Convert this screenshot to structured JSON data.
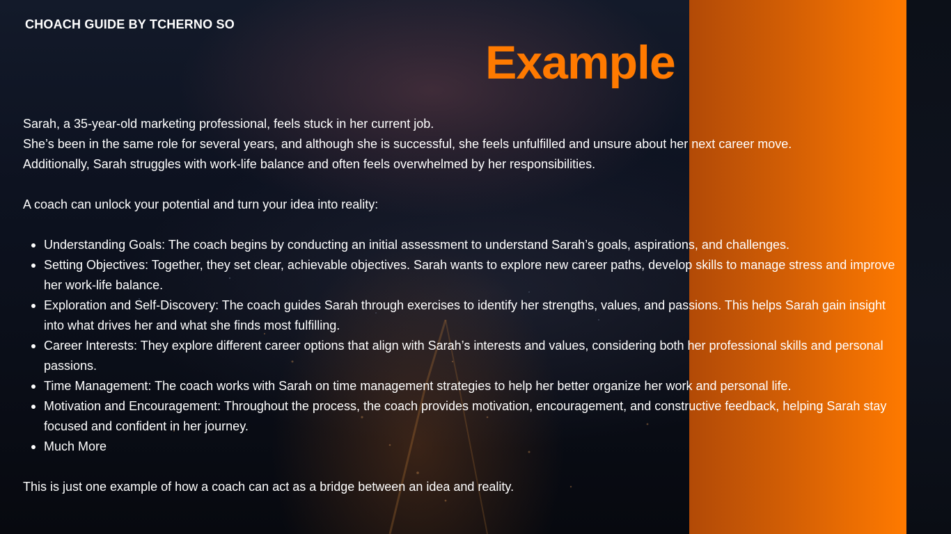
{
  "brand": "CHOACH GUIDE BY TCHERNO SO",
  "title": "Example",
  "intro": [
    "Sarah, a 35-year-old marketing professional, feels stuck in her current job.",
    "She’s been in the same role for several years, and although she is successful, she feels unfulfilled and unsure about her next career move.",
    "Additionally, Sarah struggles with work-life balance and often feels overwhelmed by her responsibilities."
  ],
  "lead": "A coach can unlock your potential and turn your idea into reality:",
  "bullets": [
    "Understanding Goals: The coach begins by conducting an initial assessment to understand Sarah’s goals, aspirations, and challenges.",
    "Setting Objectives: Together, they set clear, achievable objectives. Sarah wants to explore new career paths, develop skills to manage stress and improve her work-life balance.",
    "Exploration and Self-Discovery: The coach guides Sarah through exercises to identify her strengths, values, and passions. This helps Sarah gain insight into what drives her and what she finds most fulfilling.",
    "Career Interests: They explore different career options that align with Sarah’s interests and values, considering both her professional skills and personal passions.",
    "Time Management: The coach works with Sarah on time management strategies to help her better organize her work and personal life.",
    "Motivation and Encouragement: Throughout the process, the coach provides motivation, encouragement, and constructive feedback, helping Sarah stay focused and confident in her journey.",
    "Much More"
  ],
  "conclusion": "This is just one example of how a coach can act as a bridge between an idea and reality.",
  "colors": {
    "accent": "#ff7a00",
    "band_start": "#b24a06",
    "band_end": "#ff7a00",
    "background": "#0b0e17",
    "text": "#ffffff"
  }
}
